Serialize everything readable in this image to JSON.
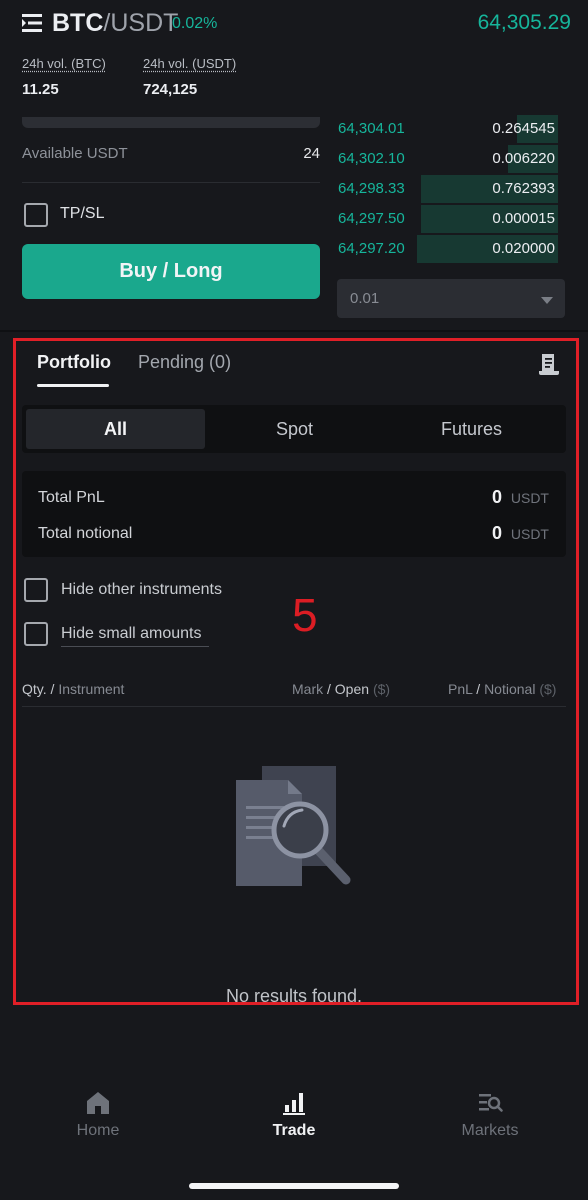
{
  "header": {
    "pair_base": "BTC",
    "pair_quote": "/USDT",
    "change": "0.02%",
    "last_price": "64,305.29"
  },
  "stats": {
    "vol_btc_label": "24h vol. (BTC)",
    "vol_btc_value": "11.25",
    "vol_usdt_label": "24h vol. (USDT)",
    "vol_usdt_value": "724,125"
  },
  "order_form": {
    "available_label": "Available USDT",
    "available_value": "24",
    "tpsl_label": "TP/SL",
    "tpsl_checked": false,
    "buy_button": "Buy / Long"
  },
  "order_book": {
    "rows": [
      {
        "price": "64,304.01",
        "qty": "0.264545",
        "depth": 0.18
      },
      {
        "price": "64,302.10",
        "qty": "0.006220",
        "depth": 0.22
      },
      {
        "price": "64,298.33",
        "qty": "0.762393",
        "depth": 0.6
      },
      {
        "price": "64,297.50",
        "qty": "0.000015",
        "depth": 0.6
      },
      {
        "price": "64,297.20",
        "qty": "0.020000",
        "depth": 0.62
      }
    ],
    "precision_select": "0.01"
  },
  "portfolio": {
    "tabs": [
      "Portfolio",
      "Pending (0)"
    ],
    "active_tab": 0,
    "segments": [
      "All",
      "Spot",
      "Futures"
    ],
    "active_segment": 0,
    "total_pnl_label": "Total PnL",
    "total_pnl_value": "0",
    "total_pnl_unit": "USDT",
    "total_notional_label": "Total notional",
    "total_notional_value": "0",
    "total_notional_unit": "USDT",
    "hide_other_label": "Hide other instruments",
    "hide_small_label": "Hide small amounts",
    "columns": {
      "qty": "Qty.",
      "sep": " / ",
      "instrument": "Instrument",
      "mark": "Mark",
      "open": "Open",
      "usd": "($)",
      "pnl": "PnL",
      "notional": "Notional"
    },
    "empty_text": "No results found."
  },
  "annotation": {
    "step_number": "5",
    "highlight_color": "#e01f27"
  },
  "nav": {
    "items": [
      {
        "label": "Home",
        "icon": "home-icon",
        "active": false
      },
      {
        "label": "Trade",
        "icon": "chart-bars-icon",
        "active": true
      },
      {
        "label": "Markets",
        "icon": "list-search-icon",
        "active": false
      }
    ]
  },
  "colors": {
    "accent_green": "#16b59b",
    "buy_button": "#1aa88d",
    "background": "#17181c"
  }
}
